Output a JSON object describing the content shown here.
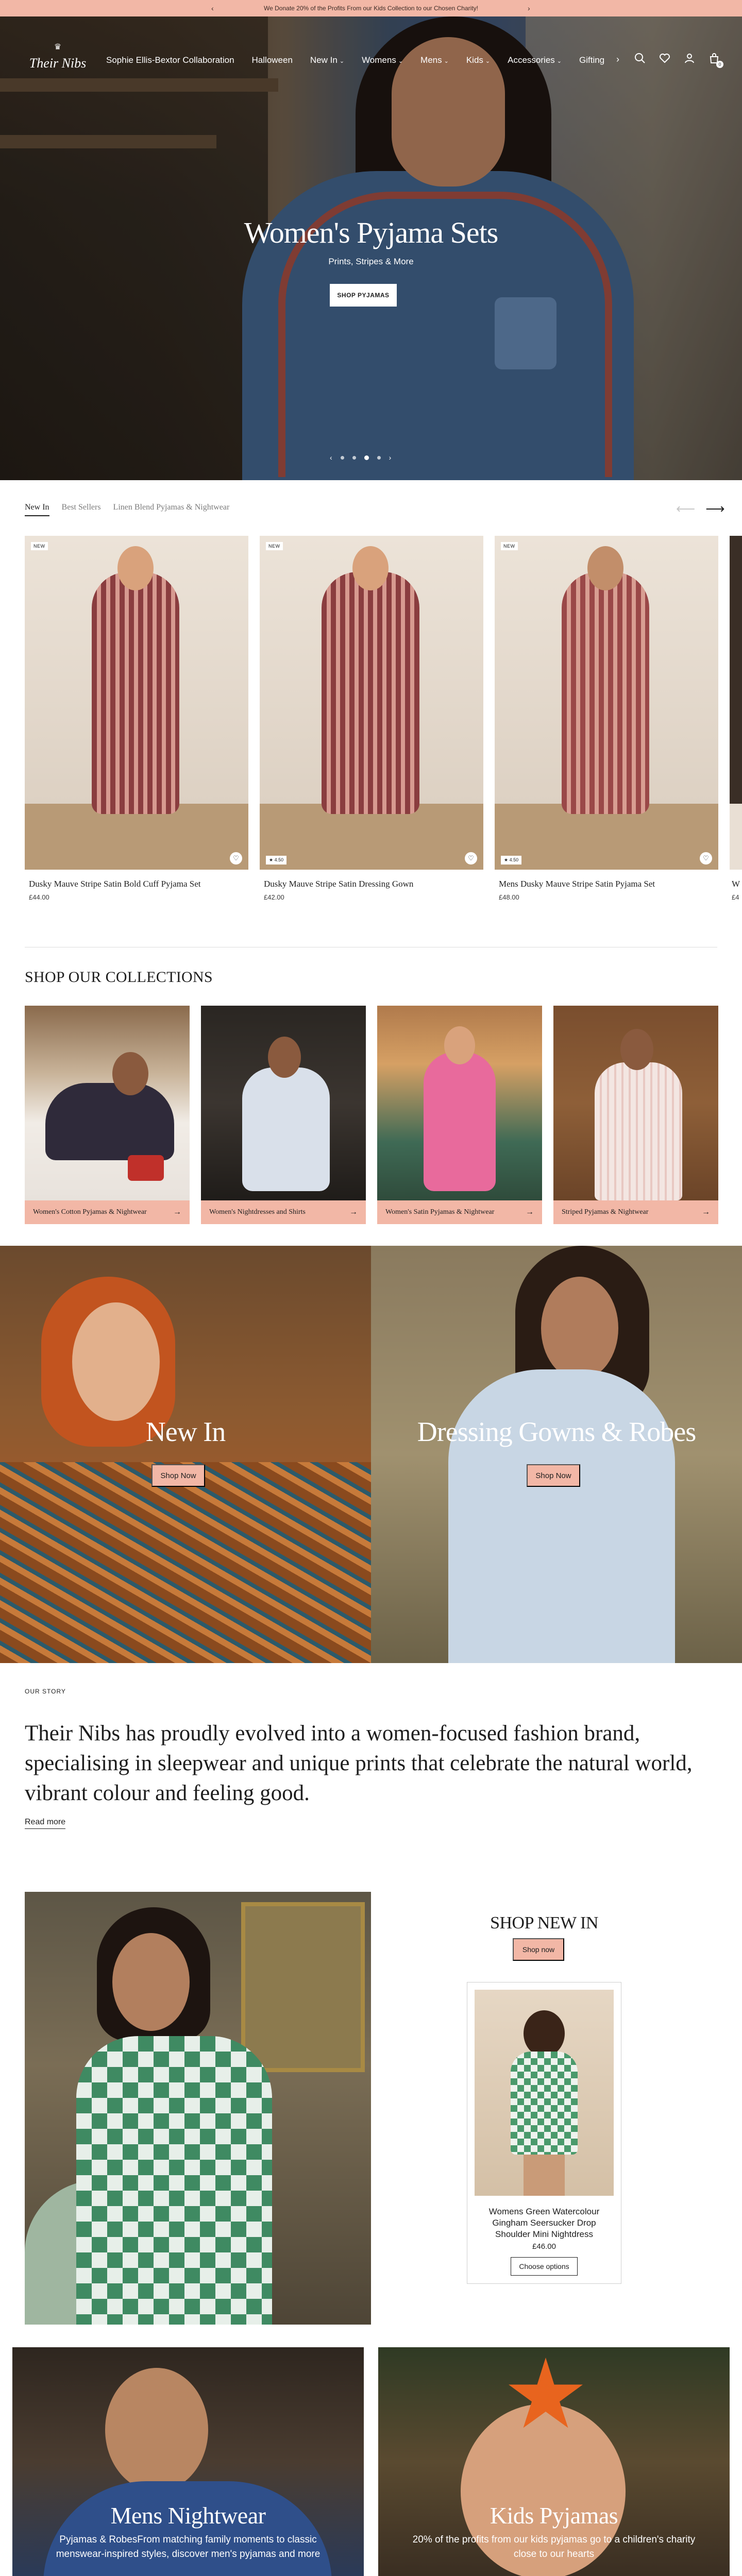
{
  "announcement": {
    "text": "We Donate 20% of the Profits From our Kids Collection to our Chosen Charity!",
    "prev_icon": "chevron-left-icon",
    "next_icon": "chevron-right-icon"
  },
  "header": {
    "logo_text": "Their Nibs",
    "nav": [
      {
        "label": "Sophie Ellis-Bextor Collaboration",
        "has_dropdown": false
      },
      {
        "label": "Halloween",
        "has_dropdown": false
      },
      {
        "label": "New In",
        "has_dropdown": true
      },
      {
        "label": "Womens",
        "has_dropdown": true
      },
      {
        "label": "Mens",
        "has_dropdown": true
      },
      {
        "label": "Kids",
        "has_dropdown": true
      },
      {
        "label": "Accessories",
        "has_dropdown": true
      },
      {
        "label": "Gifting",
        "has_dropdown": false
      }
    ],
    "cart_count": "0",
    "icons": [
      "search-icon",
      "heart-icon",
      "account-icon",
      "cart-icon"
    ]
  },
  "hero": {
    "title": "Women's Pyjama Sets",
    "subtitle": "Prints, Stripes & More",
    "button": "SHOP PYJAMAS",
    "slide_count": 5,
    "active_slide": 3
  },
  "product_tabs": {
    "tabs": [
      "New In",
      "Best Sellers",
      "Linen Blend Pyjamas & Nightwear"
    ],
    "active": 0
  },
  "products": [
    {
      "name": "Dusky Mauve Stripe Satin Bold Cuff Pyjama Set",
      "price": "£44.00",
      "badge": "NEW",
      "rating": ""
    },
    {
      "name": "Dusky Mauve Stripe Satin Dressing Gown",
      "price": "£42.00",
      "badge": "NEW",
      "rating": "4.50"
    },
    {
      "name": "Mens Dusky Mauve Stripe Satin Pyjama Set",
      "price": "£48.00",
      "badge": "NEW",
      "rating": "4.50"
    },
    {
      "name": "W",
      "price": "£4",
      "badge": "",
      "rating": ""
    }
  ],
  "collections": {
    "title": "SHOP OUR COLLECTIONS",
    "items": [
      {
        "label": "Women's Cotton Pyjamas & Nightwear"
      },
      {
        "label": "Women's Nightdresses and Shirts"
      },
      {
        "label": "Women's Satin Pyjamas & Nightwear"
      },
      {
        "label": "Striped Pyjamas & Nightwear"
      }
    ]
  },
  "split_banners": [
    {
      "title": "New In",
      "button": "Shop Now"
    },
    {
      "title": "Dressing Gowns & Robes",
      "button": "Shop Now"
    }
  ],
  "story": {
    "label": "OUR STORY",
    "text": "Their Nibs has proudly evolved into a women-focused fashion brand, specialising in sleepwear and unique prints that celebrate the natural world, vibrant colour and feeling good.",
    "link": "Read more"
  },
  "shop_new_in": {
    "title": "SHOP NEW IN",
    "button": "Shop now",
    "product": {
      "name": "Womens Green Watercolour Gingham Seersucker Drop Shoulder Mini Nightdress",
      "price": "£46.00",
      "button": "Choose options"
    }
  },
  "bottom_tiles": [
    {
      "title": "Mens Nightwear",
      "subtitle": "Pyjamas & RobesFrom matching family moments to classic menswear-inspired styles, discover men's pyjamas and more"
    },
    {
      "title": "Kids Pyjamas",
      "subtitle": "20% of the profits from our kids pyjamas go to a children's charity close to our hearts"
    }
  ],
  "colors": {
    "accent": "#f2b7a6",
    "text": "#1e1e1e",
    "background": "#ffffff"
  }
}
